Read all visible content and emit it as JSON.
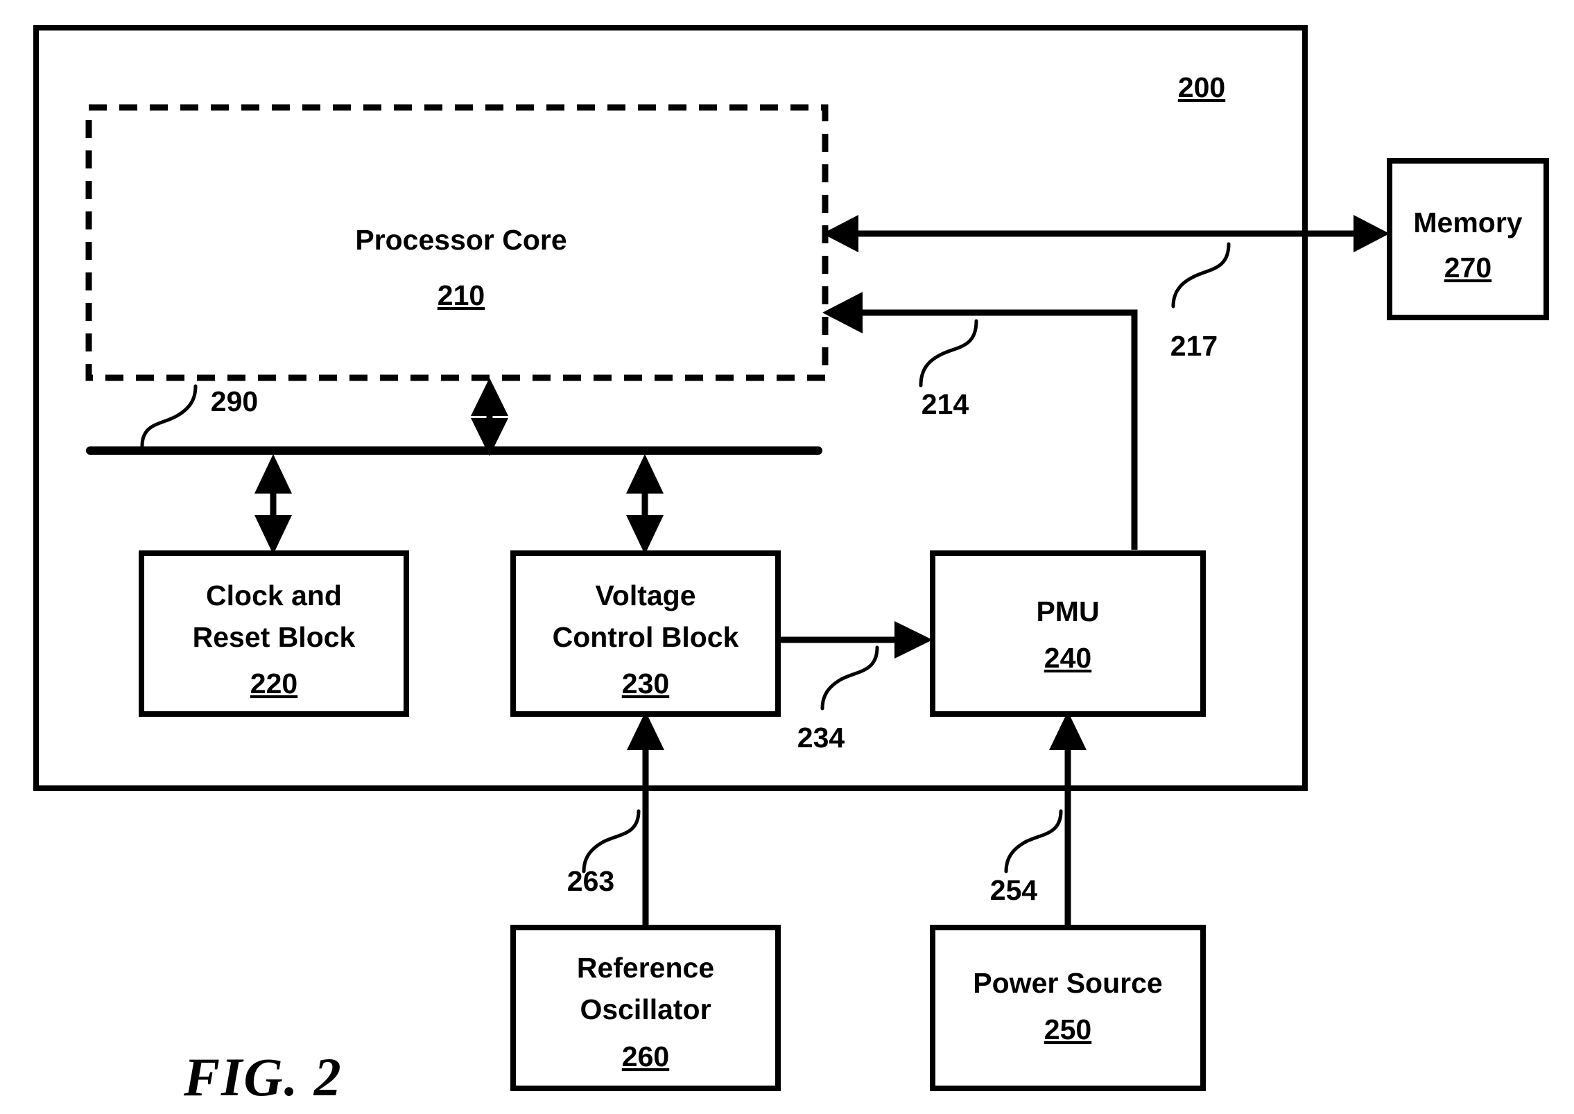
{
  "figure": {
    "caption": "FIG. 2",
    "system_ref": "200"
  },
  "blocks": [
    {
      "id": "processor-core",
      "lines": [
        "Processor Core"
      ],
      "ref": "210",
      "style": "dashed"
    },
    {
      "id": "memory",
      "lines": [
        "Memory"
      ],
      "ref": "270",
      "style": "solid"
    },
    {
      "id": "clock-and-reset-block",
      "lines": [
        "Clock and",
        "Reset Block"
      ],
      "ref": "220",
      "style": "solid"
    },
    {
      "id": "voltage-control-block",
      "lines": [
        "Voltage",
        "Control Block"
      ],
      "ref": "230",
      "style": "solid"
    },
    {
      "id": "pmu",
      "lines": [
        "PMU"
      ],
      "ref": "240",
      "style": "solid"
    },
    {
      "id": "reference-oscillator",
      "lines": [
        "Reference",
        "Oscillator"
      ],
      "ref": "260",
      "style": "solid"
    },
    {
      "id": "power-source",
      "lines": [
        "Power Source"
      ],
      "ref": "250",
      "style": "solid"
    }
  ],
  "connection_refs": {
    "memory_bus": "217",
    "pmu_to_core": "214",
    "vcb_to_pmu": "234",
    "internal_bus": "290",
    "osc_to_vcb": "263",
    "power_to_pmu": "254"
  },
  "colors": {
    "ink": "#000000",
    "paper": "#ffffff"
  }
}
